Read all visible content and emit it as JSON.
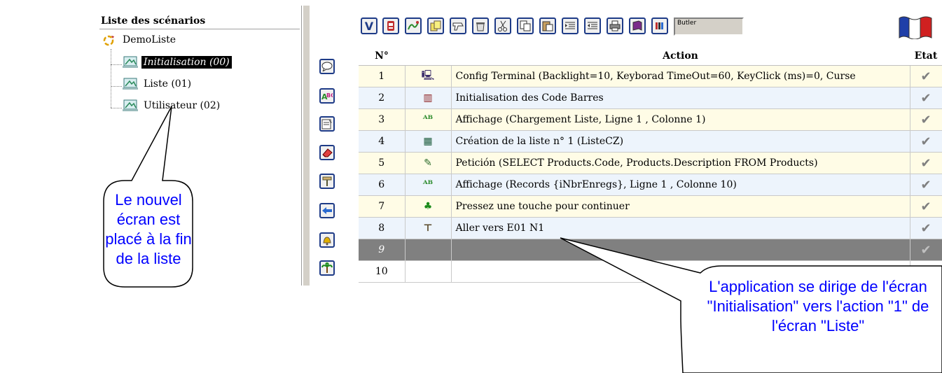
{
  "tree": {
    "title": "Liste des scénarios",
    "root": "DemoListe",
    "items": [
      {
        "label": "Initialisation (00)",
        "selected": true
      },
      {
        "label": "Liste (01)",
        "selected": false
      },
      {
        "label": "Utilisateur (02)",
        "selected": false
      }
    ]
  },
  "toolbar": {
    "first_button": "V",
    "field_text": "Butler",
    "icons": [
      "v-icon",
      "badge-icon",
      "route-icon",
      "cards-icon",
      "scanner-icon",
      "trash-icon",
      "scissors-icon",
      "copy-icon",
      "paste-icon",
      "indent-icon",
      "outdent-icon",
      "print-icon",
      "book-icon",
      "help-icon",
      "flag-icon"
    ]
  },
  "side_toolbar": {
    "icons": [
      "speech-bubble-icon",
      "display-text-icon",
      "form-icon",
      "eraser-icon",
      "signpost-icon",
      "back-arrow-icon",
      "bell-icon",
      "palm-tree-icon"
    ]
  },
  "table": {
    "headers": {
      "num": "N°",
      "action": "Action",
      "state": "Etat"
    },
    "rows": [
      {
        "num": "1",
        "icon": "🖳",
        "icon_name": "terminal-icon",
        "action": "Config Terminal (Backlight=10, Keyborad TimeOut=60, KeyClick (ms)=0, Curse",
        "state": "✔"
      },
      {
        "num": "2",
        "icon": "▥",
        "icon_name": "barcode-icon",
        "action": "Initialisation des Code Barres",
        "state": "✔"
      },
      {
        "num": "3",
        "icon": "ᴬᴮ",
        "icon_name": "display-text-icon",
        "action": "Affichage (Chargement Liste, Ligne 1 , Colonne 1)",
        "state": "✔"
      },
      {
        "num": "4",
        "icon": "▦",
        "icon_name": "list-create-icon",
        "action": "Création de la liste n° 1 (ListeCZ)",
        "state": "✔"
      },
      {
        "num": "5",
        "icon": "✎",
        "icon_name": "sql-request-icon",
        "action": "Petición (SELECT Products.Code, Products.Description FROM Products)",
        "state": "✔"
      },
      {
        "num": "6",
        "icon": "ᴬᴮ",
        "icon_name": "display-text-icon",
        "action": "Affichage (Records {iNbrEnregs}, Ligne 1 , Colonne 10)",
        "state": "✔"
      },
      {
        "num": "7",
        "icon": "♣",
        "icon_name": "palm-tree-icon",
        "action": "Pressez une touche pour continuer",
        "state": "✔"
      },
      {
        "num": "8",
        "icon": "⊤",
        "icon_name": "signpost-icon",
        "action": "Aller vers E01 N1",
        "state": "✔"
      },
      {
        "num": "9",
        "icon": "",
        "icon_name": "",
        "action": "",
        "state": "✔"
      },
      {
        "num": "10",
        "icon": "",
        "icon_name": "",
        "action": "",
        "state": ""
      }
    ]
  },
  "callouts": {
    "left": "Le nouvel écran est placé à la fin de la liste",
    "right": "L'application se dirige de l'écran \"Initialisation\" vers l'action \"1\" de l'écran \"Liste\""
  }
}
